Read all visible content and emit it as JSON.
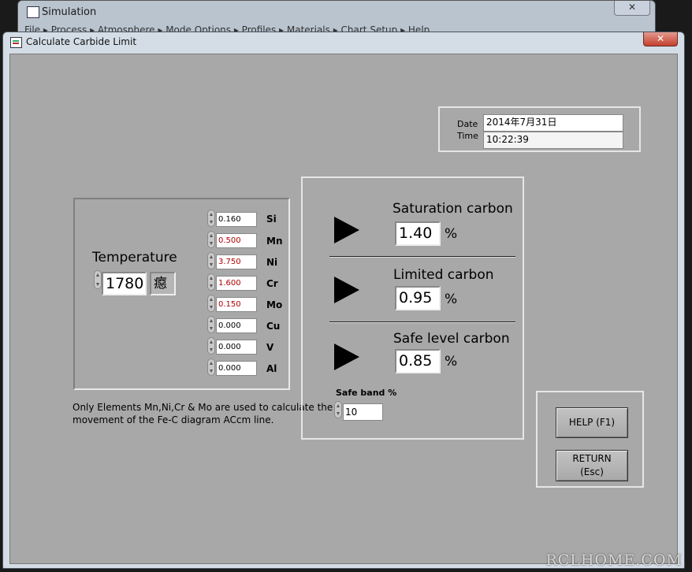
{
  "background_window": {
    "title": "Simulation",
    "close_label": "✕",
    "menu_text": "File    ▸  Process  ▸  Atmosphere  ▸  Mode Options  ▸  Profiles  ▸  Materials  ▸  Chart Setup  ▸  Help"
  },
  "window": {
    "title": "Calculate Carbide Limit",
    "close_label": "✕"
  },
  "datetime": {
    "date_label": "Date",
    "time_label": "Time",
    "date_value": "2014年7月31日",
    "time_value": "10:22:39"
  },
  "temperature": {
    "label": "Temperature",
    "value": "1780",
    "unit": "癋"
  },
  "elements": [
    {
      "name": "Si",
      "value": "0.160",
      "color": "#000000"
    },
    {
      "name": "Mn",
      "value": "0.500",
      "color": "#b00000"
    },
    {
      "name": "Ni",
      "value": "3.750",
      "color": "#b00000"
    },
    {
      "name": "Cr",
      "value": "1.600",
      "color": "#b00000"
    },
    {
      "name": "Mo",
      "value": "0.150",
      "color": "#b00000"
    },
    {
      "name": "Cu",
      "value": "0.000",
      "color": "#000000"
    },
    {
      "name": "V",
      "value": "0.000",
      "color": "#000000"
    },
    {
      "name": "Al",
      "value": "0.000",
      "color": "#000000"
    }
  ],
  "note": "Only Elements Mn,Ni,Cr & Mo are used to calculate the\nmovement of the Fe-C diagram ACcm line.",
  "results": {
    "saturation_label": "Saturation carbon",
    "saturation_value": "1.40",
    "limited_label": "Limited carbon",
    "limited_value": "0.95",
    "safe_label": "Safe level carbon",
    "safe_value": "0.85",
    "percent": "%"
  },
  "safe_band": {
    "label": "Safe band %",
    "value": "10"
  },
  "buttons": {
    "help": "HELP (F1)",
    "return": "RETURN\n(Esc)"
  },
  "watermark": "RCLHOME.COM"
}
